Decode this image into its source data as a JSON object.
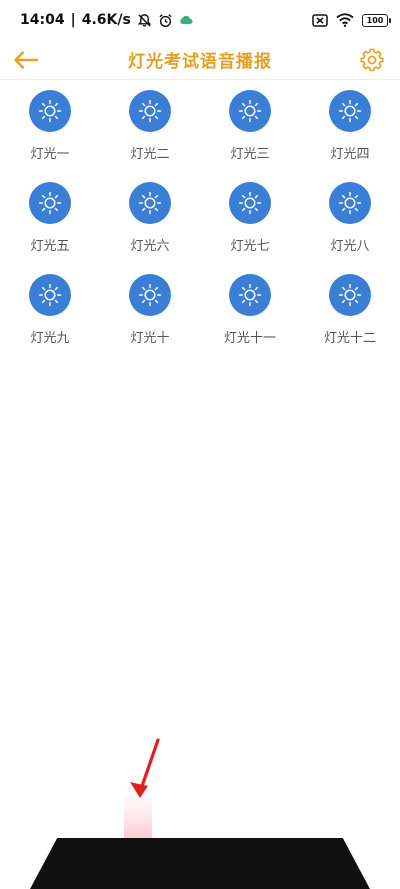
{
  "status_bar": {
    "time": "14:04",
    "separator": "|",
    "network_speed": "4.6K/s",
    "battery": "100"
  },
  "header": {
    "title": "灯光考试语音播报",
    "accent_color": "#e3a124"
  },
  "icon_color": "#3a7fd5",
  "lights": [
    {
      "label": "灯光一"
    },
    {
      "label": "灯光二"
    },
    {
      "label": "灯光三"
    },
    {
      "label": "灯光四"
    },
    {
      "label": "灯光五"
    },
    {
      "label": "灯光六"
    },
    {
      "label": "灯光七"
    },
    {
      "label": "灯光八"
    },
    {
      "label": "灯光九"
    },
    {
      "label": "灯光十"
    },
    {
      "label": "灯光十一"
    },
    {
      "label": "灯光十二"
    }
  ]
}
